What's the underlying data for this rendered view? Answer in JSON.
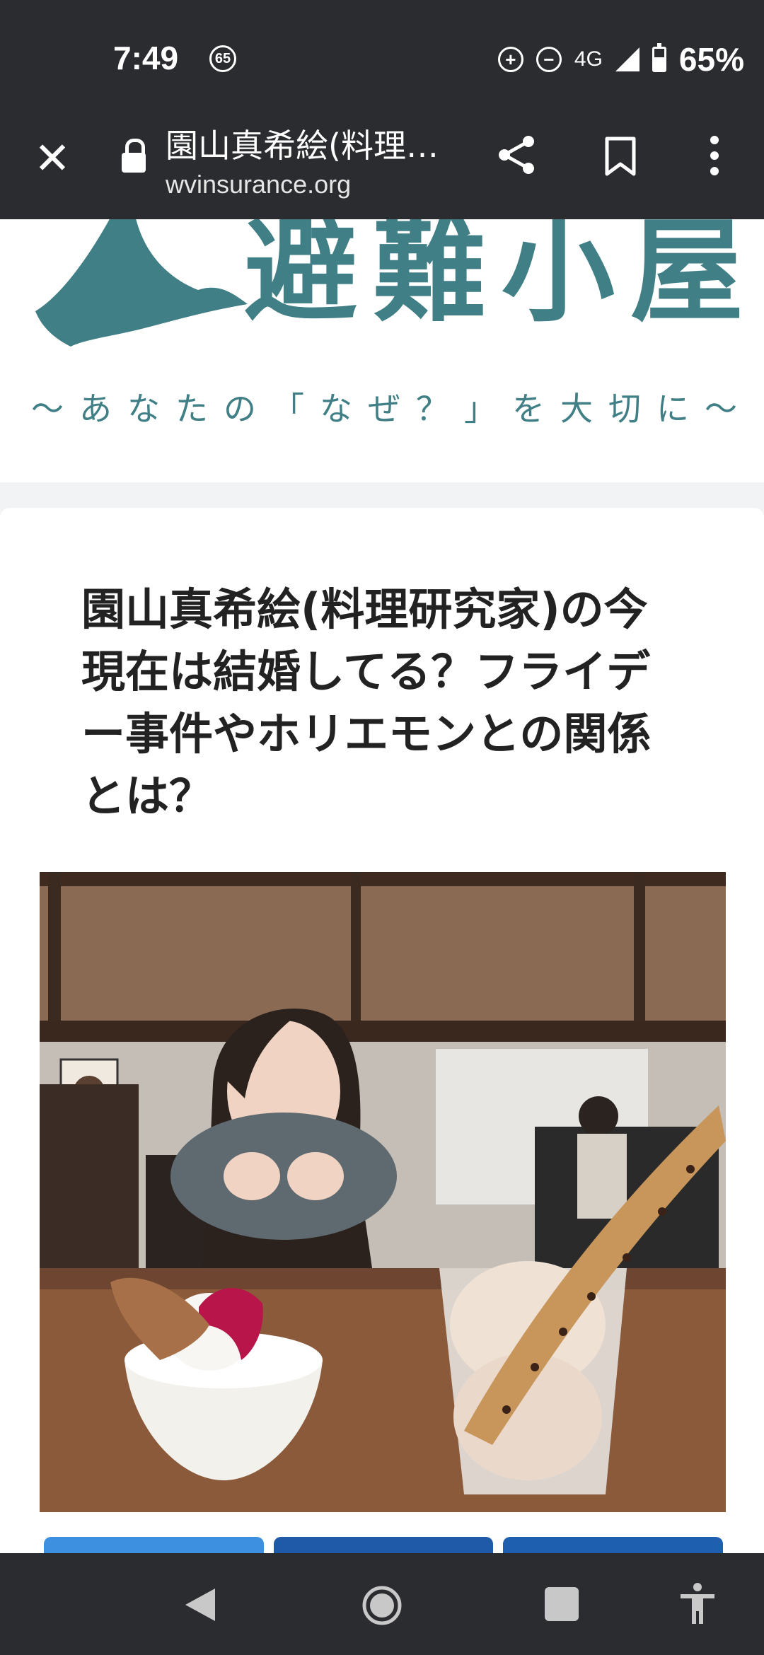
{
  "status_bar": {
    "time": "7:49",
    "notification_badge": "65",
    "network": "4G",
    "battery": "65%",
    "icons": [
      "data-saver-icon",
      "do-not-disturb-icon",
      "signal-icon",
      "battery-icon"
    ]
  },
  "browser_toolbar": {
    "page_title": "園山真希絵(料理研究家)の今現在は結婚してる？フライデー事件やホリエモンとの関係とは？",
    "url": "wvinsurance.org",
    "icons": [
      "close-icon",
      "lock-icon",
      "share-icon",
      "bookmark-icon",
      "more-vert-icon"
    ]
  },
  "site_banner": {
    "logo_title": "避難小屋",
    "tagline": "〜あなたの「なぜ？」を大切に〜",
    "brand_color": "#3f7f85"
  },
  "article": {
    "title": "園山真希絵(料理研究家)の今現在は結婚してる？フライデー事件やホリエモンとの関係とは？"
  },
  "share_buttons": {
    "colors": [
      "#3d8fe0",
      "#1e5aa8",
      "#1f5fb0"
    ]
  },
  "nav_bar": {
    "icons": [
      "back-icon",
      "home-icon",
      "recents-icon",
      "accessibility-icon"
    ]
  }
}
